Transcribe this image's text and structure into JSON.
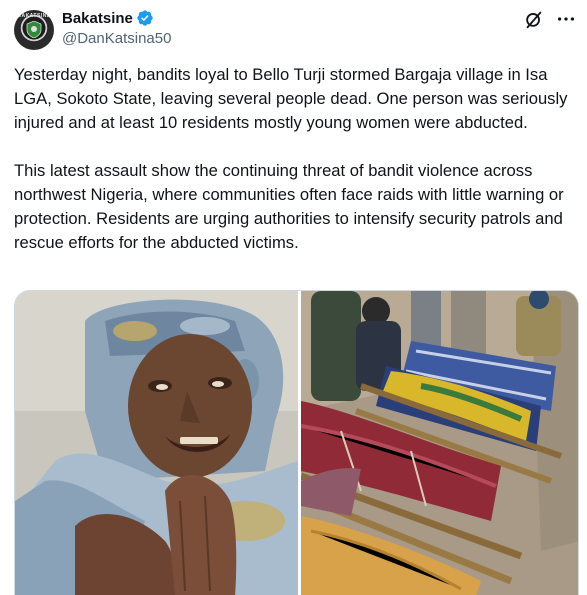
{
  "author": {
    "display_name": "Bakatsine",
    "handle": "@DanKatsina50",
    "verified": true,
    "avatar_ring_text": "BAKATSINE"
  },
  "header_icons": {
    "grok": "grok-icon",
    "more": "more-icon"
  },
  "tweet": {
    "paragraphs": [
      "Yesterday night, bandits loyal to Bello Turji stormed Bargaja village in Isa LGA, Sokoto State, leaving several people dead. One person was seriously injured and at least 10 residents mostly young women were abducted.",
      "This latest assault show the continuing threat of bandit violence across northwest Nigeria, where communities often face raids with little warning or protection. Residents are urging authorities to intensify security patrols and rescue efforts for the abducted victims."
    ]
  },
  "media": {
    "count": 2,
    "items": [
      {
        "name": "photo-man-in-camouflage-turban"
      },
      {
        "name": "photo-bodies-wrapped-on-stretchers"
      }
    ]
  },
  "colors": {
    "text": "#0f1419",
    "secondary": "#536471",
    "verified": "#1d9bf0",
    "border": "#cfd9de"
  }
}
